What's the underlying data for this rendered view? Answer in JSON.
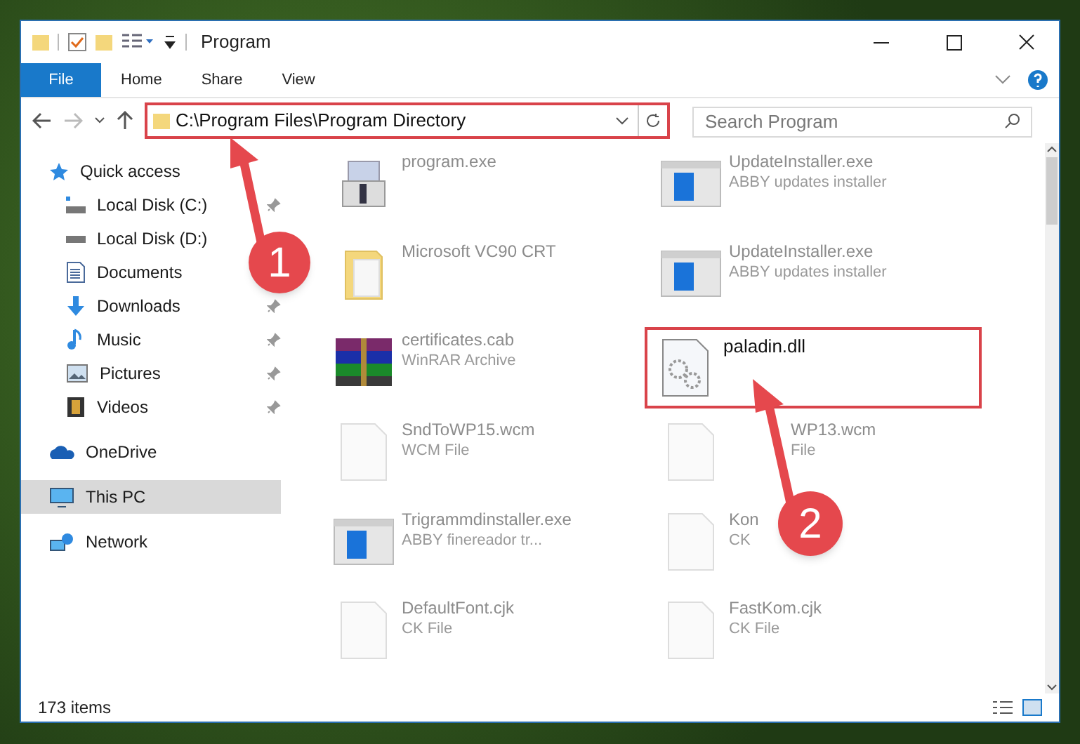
{
  "window": {
    "title": "Program"
  },
  "ribbon_tabs": [
    {
      "label": "File",
      "selected": true
    },
    {
      "label": "Home",
      "selected": false
    },
    {
      "label": "Share",
      "selected": false
    },
    {
      "label": "View",
      "selected": false
    }
  ],
  "address_bar": {
    "path": "C:\\Program Files\\Program Directory"
  },
  "search": {
    "placeholder": "Search Program"
  },
  "sidebar": {
    "items": [
      {
        "label": "Quick access",
        "kind": "star",
        "selected": false,
        "pinned": false,
        "children": [
          {
            "label": "Local Disk (C:)",
            "kind": "disk-c",
            "selected": false,
            "pinned": true
          },
          {
            "label": "Local Disk (D:)",
            "kind": "disk",
            "selected": false
          },
          {
            "label": "Documents",
            "kind": "documents",
            "selected": false
          },
          {
            "label": "Downloads",
            "kind": "downloads",
            "selected": false,
            "pinned": true
          },
          {
            "label": "Music",
            "kind": "music",
            "selected": false,
            "pinned": true
          },
          {
            "label": "Pictures",
            "kind": "pictures",
            "selected": false,
            "pinned": true
          },
          {
            "label": "Videos",
            "kind": "videos",
            "selected": false,
            "pinned": true
          }
        ]
      },
      {
        "label": "OneDrive",
        "kind": "cloud",
        "selected": false,
        "pinned": false
      },
      {
        "label": "This PC",
        "kind": "pc",
        "selected": true,
        "pinned": false
      },
      {
        "label": "Network",
        "kind": "network",
        "selected": false,
        "pinned": false
      }
    ]
  },
  "files": [
    {
      "name": "program.exe",
      "kind": "setup",
      "faded": true,
      "highlighted": false,
      "partly_hidden": false
    },
    {
      "name": "UpdateInstaller.exe",
      "type": "ABBY updates installer",
      "kind": "app",
      "faded": true,
      "highlighted": false,
      "partly_hidden": false
    },
    {
      "name": "Microsoft VC90 CRT",
      "kind": "folder",
      "faded": true,
      "highlighted": false,
      "partly_hidden": false
    },
    {
      "name": "UpdateInstaller.exe",
      "type": "ABBY updates installer",
      "kind": "app",
      "faded": true,
      "highlighted": false,
      "partly_hidden": false
    },
    {
      "name": "certificates.cab",
      "type": "WinRAR Archive",
      "kind": "archive",
      "faded": true,
      "highlighted": false,
      "partly_hidden": false
    },
    {
      "name": "paladin.dll",
      "kind": "dll",
      "faded": false,
      "highlighted": true,
      "partly_hidden": false
    },
    {
      "name": "SndToWP15.wcm",
      "type": "WCM File",
      "kind": "blank",
      "faded": true,
      "highlighted": false,
      "partly_hidden": false
    },
    {
      "name": "WP13.wcm",
      "type": "File",
      "kind": "blank",
      "faded": true,
      "highlighted": false,
      "partly_hidden": true
    },
    {
      "name": "Trigrammdinstaller.exe",
      "type": "ABBY finereador tr...",
      "kind": "app",
      "faded": true,
      "highlighted": false,
      "partly_hidden": false
    },
    {
      "name": "Kon",
      "type": "CK",
      "kind": "blank",
      "faded": true,
      "highlighted": false,
      "partly_hidden": false
    },
    {
      "name": "DefaultFont.cjk",
      "type": "CK File",
      "kind": "blank",
      "faded": true,
      "highlighted": false,
      "partly_hidden": false
    },
    {
      "name": "FastKom.cjk",
      "type": "CK File",
      "kind": "blank",
      "faded": true,
      "highlighted": false,
      "partly_hidden": false
    }
  ],
  "status_bar": {
    "count": "173 items"
  },
  "annotations": [
    {
      "number": "1"
    },
    {
      "number": "2"
    }
  ]
}
